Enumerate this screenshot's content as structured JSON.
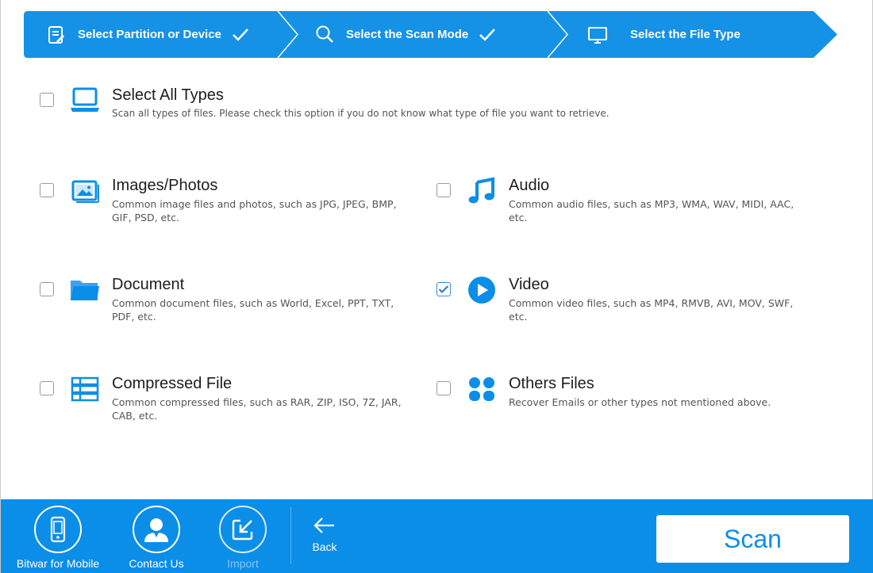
{
  "colors": {
    "accent": "#0b8ee8",
    "stepper": "#1592e6",
    "white": "#ffffff"
  },
  "stepper": {
    "steps": [
      {
        "label": "Select Partition or Device",
        "icon": "clipboard-icon",
        "done": true
      },
      {
        "label": "Select the Scan Mode",
        "icon": "search-icon",
        "done": true
      },
      {
        "label": "Select the File Type",
        "icon": "monitor-icon",
        "done": false
      }
    ]
  },
  "options": {
    "all": {
      "title": "Select All Types",
      "desc": "Scan all types of files. Please check this option if you do not know what type of file you want to retrieve.",
      "checked": false,
      "icon": "laptop-icon"
    },
    "images": {
      "title": "Images/Photos",
      "desc": "Common image files and photos, such as JPG, JPEG, BMP, GIF, PSD, etc.",
      "checked": false,
      "icon": "image-icon"
    },
    "audio": {
      "title": "Audio",
      "desc": "Common audio files, such as MP3, WMA, WAV, MIDI, AAC, etc.",
      "checked": false,
      "icon": "music-note-icon"
    },
    "document": {
      "title": "Document",
      "desc": "Common document files, such as World, Excel, PPT, TXT, PDF, etc.",
      "checked": false,
      "icon": "folder-icon"
    },
    "video": {
      "title": "Video",
      "desc": "Common video files, such as MP4, RMVB, AVI, MOV, SWF, etc.",
      "checked": true,
      "icon": "play-icon"
    },
    "compressed": {
      "title": "Compressed File",
      "desc": "Common compressed files, such as RAR, ZIP, ISO, 7Z, JAR, CAB, etc.",
      "checked": false,
      "icon": "archive-icon"
    },
    "others": {
      "title": "Others Files",
      "desc": "Recover Emails or other types not mentioned above.",
      "checked": false,
      "icon": "grid-dots-icon"
    }
  },
  "bottom": {
    "mobile_label": "Bitwar for Mobile",
    "contact_label": "Contact Us",
    "import_label": "Import",
    "back_label": "Back",
    "scan_label": "Scan"
  }
}
